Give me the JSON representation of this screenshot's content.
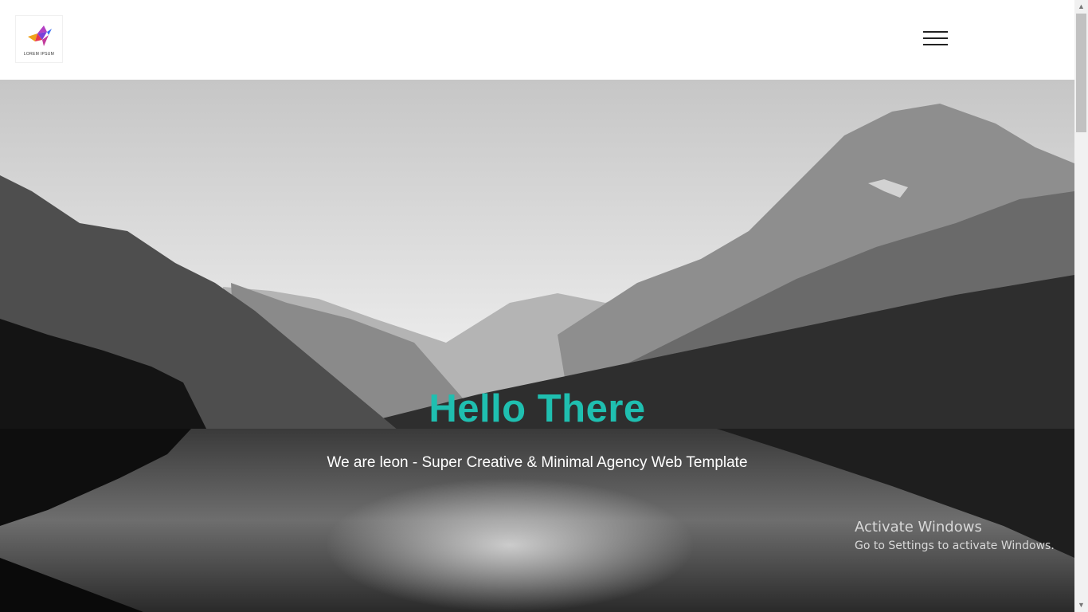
{
  "header": {
    "logo_text": "LOREM IPSUM",
    "menu_icon": "hamburger-menu-icon"
  },
  "loader": {
    "progress": 0.2
  },
  "hero": {
    "title": "Hello There",
    "subtitle": "We are leon - Super Creative & Minimal Agency Web Template",
    "title_color": "#1fbfb0"
  },
  "watermark": {
    "title": "Activate Windows",
    "subtitle": "Go to Settings to activate Windows."
  },
  "scrollbar": {
    "up_icon": "scroll-up-arrow-icon",
    "down_icon": "scroll-down-arrow-icon"
  }
}
